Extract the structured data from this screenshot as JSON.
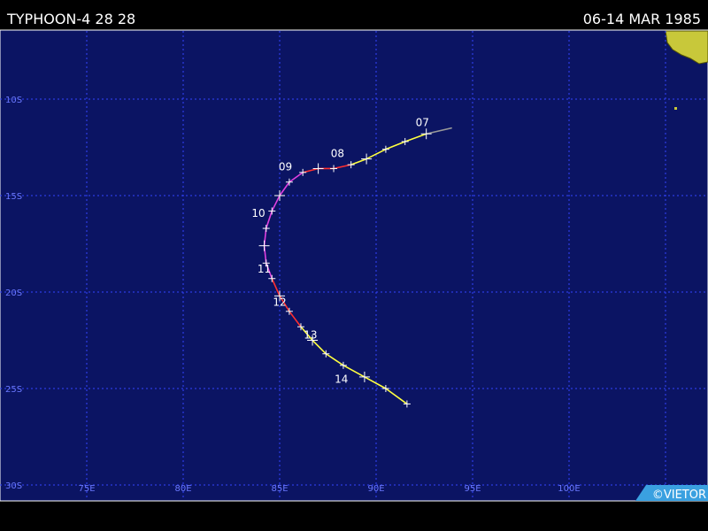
{
  "header": {
    "title": "TYPHOON-4 28 28",
    "date_range": "06-14 MAR 1985"
  },
  "map": {
    "lon_range": [
      70,
      107
    ],
    "lat_range": [
      -30,
      -6
    ],
    "lat_labels": [
      "10S",
      "15S",
      "20S",
      "25S",
      "30S"
    ],
    "lon_labels": [
      "75E",
      "80E",
      "85E",
      "90E",
      "95E",
      "100E"
    ],
    "grid_color": "#3344ff",
    "ocean_color": "#0b1463",
    "land_color": "#c8c83a"
  },
  "track": {
    "segment_colors": {
      "depression": "#999999",
      "storm": "#ffff40",
      "strong_storm": "#ff3030",
      "typhoon": "#e040e0"
    },
    "day_labels": [
      "07",
      "08",
      "09",
      "10",
      "11",
      "12",
      "13",
      "14"
    ]
  },
  "credit": "©VIETOR"
}
